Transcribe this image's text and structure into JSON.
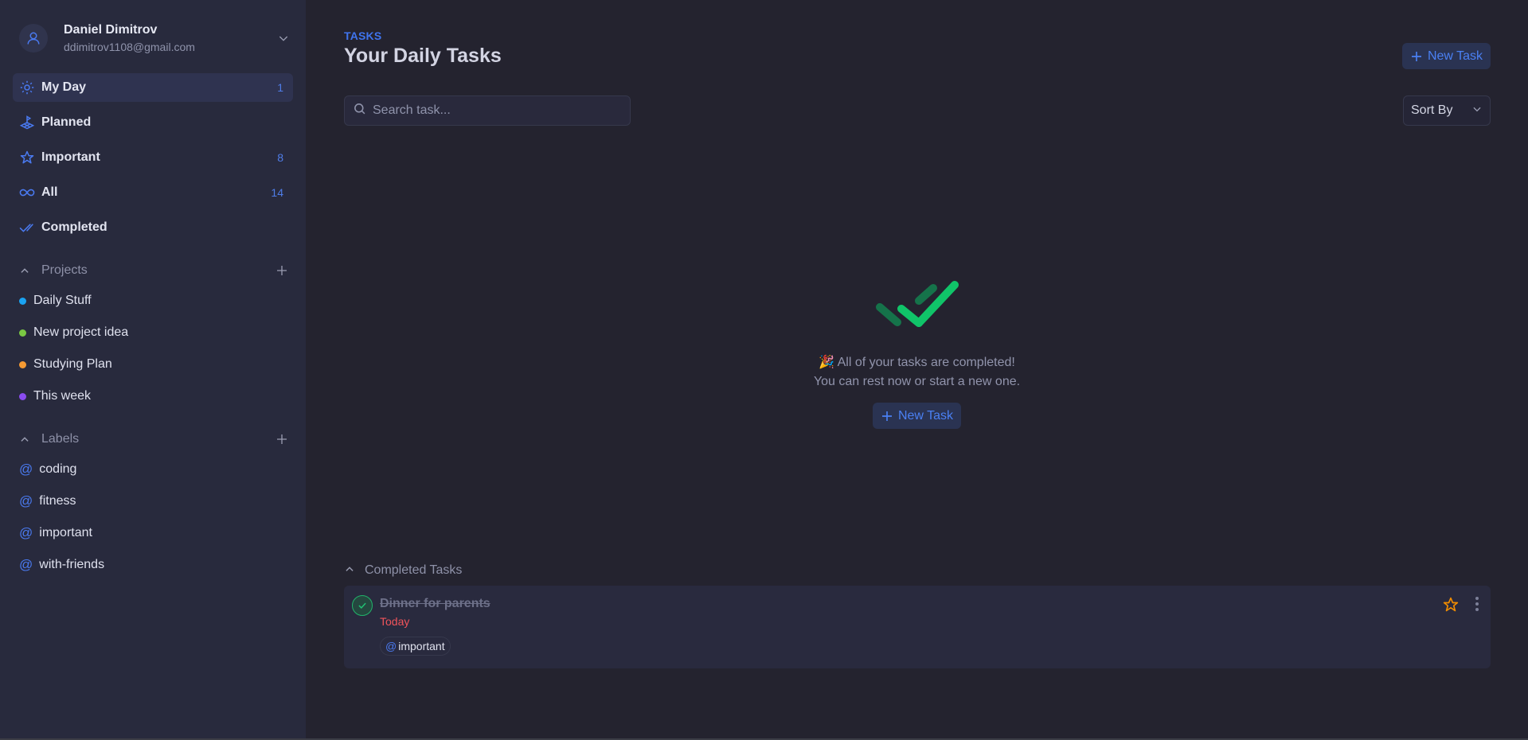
{
  "user": {
    "name": "Daniel Dimitrov",
    "email": "ddimitrov1108@gmail.com"
  },
  "nav": [
    {
      "label": "My Day",
      "icon": "sun-icon",
      "count": "1",
      "active": true
    },
    {
      "label": "Planned",
      "icon": "planned-flag-icon",
      "count": ""
    },
    {
      "label": "Important",
      "icon": "star-icon",
      "count": "8"
    },
    {
      "label": "All",
      "icon": "infinity-icon",
      "count": "14"
    },
    {
      "label": "Completed",
      "icon": "double-check-icon",
      "count": ""
    }
  ],
  "projects": {
    "title": "Projects",
    "items": [
      {
        "label": "Daily Stuff",
        "color": "#1aa3f2"
      },
      {
        "label": "New project idea",
        "color": "#7ac843"
      },
      {
        "label": "Studying Plan",
        "color": "#f59a33"
      },
      {
        "label": "This week",
        "color": "#8a4cf0"
      }
    ]
  },
  "labels": {
    "title": "Labels",
    "at_symbol": "@",
    "items": [
      {
        "label": "coding"
      },
      {
        "label": "fitness"
      },
      {
        "label": "important"
      },
      {
        "label": "with-friends"
      }
    ]
  },
  "header": {
    "eyebrow": "TASKS",
    "title": "Your Daily Tasks",
    "new_task_label": "New Task"
  },
  "search": {
    "placeholder": "Search task...",
    "value": ""
  },
  "sort": {
    "label": "Sort By"
  },
  "empty_state": {
    "emoji": "🎉",
    "line1": "All of your tasks are completed!",
    "line2": "You can rest now or start a new one.",
    "button_label": "New Task"
  },
  "completed": {
    "title": "Completed Tasks",
    "tasks": [
      {
        "title": "Dinner for parents",
        "date": "Today",
        "completed": true,
        "important": true,
        "labels": [
          {
            "at": "@",
            "name": "important"
          }
        ]
      }
    ]
  },
  "colors": {
    "accent": "#4a80f3",
    "success": "#10c469",
    "danger": "#f0545b",
    "star": "#f08c00"
  }
}
